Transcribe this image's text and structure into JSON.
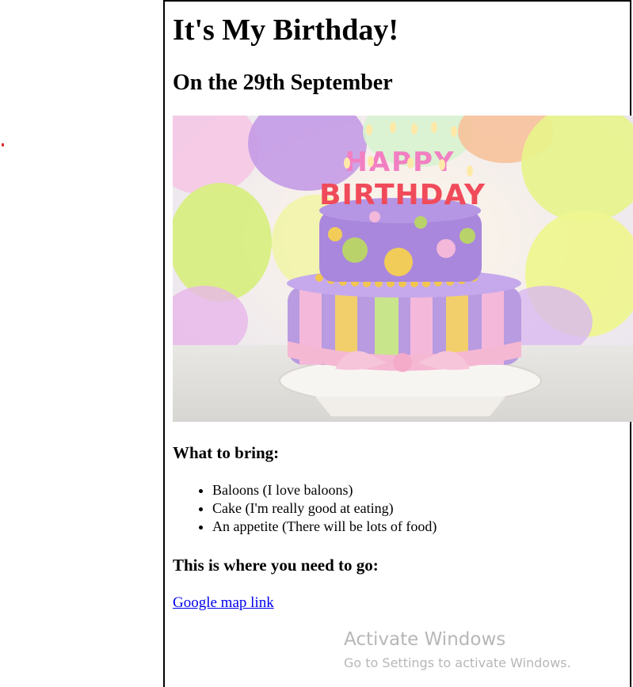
{
  "page": {
    "title": "It's My Birthday!",
    "date_heading": "On the 29th September"
  },
  "hero_image": {
    "alt": "birthday-cake-photo",
    "cake_topper": "HAPPY BIRTHDAY"
  },
  "bring_section": {
    "heading": "What to bring:",
    "items": [
      "Baloons (I love baloons)",
      "Cake (I'm really good at eating)",
      "An appetite (There will be lots of food)"
    ]
  },
  "location_section": {
    "heading": "This is where you need to go:",
    "link_text": "Google map link"
  },
  "watermark": {
    "title": "Activate Windows",
    "subtitle": "Go to Settings to activate Windows."
  },
  "colors": {
    "link": "#0000ee",
    "border": "#000000",
    "watermark": "#b7b7b7",
    "marker": "#e0242b"
  }
}
